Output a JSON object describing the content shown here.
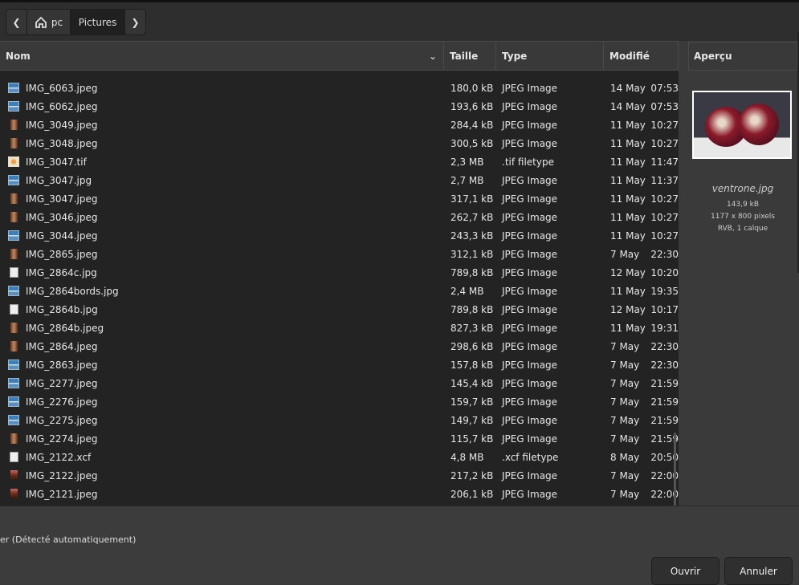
{
  "breadcrumb": {
    "home": "pc",
    "current": "Pictures"
  },
  "columns": {
    "name": "Nom",
    "size": "Taille",
    "type": "Type",
    "modified": "Modifié"
  },
  "files": [
    {
      "name": "IMG_6063.jpeg",
      "size": "180,0 kB",
      "type": "JPEG Image",
      "date": "14 May",
      "time": "07:53",
      "icon": "land"
    },
    {
      "name": "IMG_6062.jpeg",
      "size": "193,6 kB",
      "type": "JPEG Image",
      "date": "14 May",
      "time": "07:53",
      "icon": "land"
    },
    {
      "name": "IMG_3049.jpeg",
      "size": "284,4 kB",
      "type": "JPEG Image",
      "date": "11 May",
      "time": "10:27",
      "icon": "port"
    },
    {
      "name": "IMG_3048.jpeg",
      "size": "300,5 kB",
      "type": "JPEG Image",
      "date": "11 May",
      "time": "10:27",
      "icon": "port"
    },
    {
      "name": "IMG_3047.tif",
      "size": "2,3 MB",
      "type": ".tif filetype",
      "date": "11 May",
      "time": "11:47",
      "icon": "tif"
    },
    {
      "name": "IMG_3047.jpg",
      "size": "2,7 MB",
      "type": "JPEG Image",
      "date": "11 May",
      "time": "11:37",
      "icon": "land"
    },
    {
      "name": "IMG_3047.jpeg",
      "size": "317,1 kB",
      "type": "JPEG Image",
      "date": "11 May",
      "time": "10:27",
      "icon": "port"
    },
    {
      "name": "IMG_3046.jpeg",
      "size": "262,7 kB",
      "type": "JPEG Image",
      "date": "11 May",
      "time": "10:27",
      "icon": "port"
    },
    {
      "name": "IMG_3044.jpeg",
      "size": "243,3 kB",
      "type": "JPEG Image",
      "date": "11 May",
      "time": "10:27",
      "icon": "land"
    },
    {
      "name": "IMG_2865.jpeg",
      "size": "312,1 kB",
      "type": "JPEG Image",
      "date": "7 May",
      "time": "22:30",
      "icon": "port"
    },
    {
      "name": "IMG_2864c.jpg",
      "size": "789,8 kB",
      "type": "JPEG Image",
      "date": "12 May",
      "time": "10:20",
      "icon": "doc"
    },
    {
      "name": "IMG_2864bords.jpg",
      "size": "2,4 MB",
      "type": "JPEG Image",
      "date": "11 May",
      "time": "19:35",
      "icon": "land"
    },
    {
      "name": "IMG_2864b.jpg",
      "size": "789,8 kB",
      "type": "JPEG Image",
      "date": "12 May",
      "time": "10:17",
      "icon": "doc"
    },
    {
      "name": "IMG_2864b.jpeg",
      "size": "827,3 kB",
      "type": "JPEG Image",
      "date": "11 May",
      "time": "19:31",
      "icon": "port"
    },
    {
      "name": "IMG_2864.jpeg",
      "size": "298,6 kB",
      "type": "JPEG Image",
      "date": "7 May",
      "time": "22:30",
      "icon": "port"
    },
    {
      "name": "IMG_2863.jpeg",
      "size": "157,8 kB",
      "type": "JPEG Image",
      "date": "7 May",
      "time": "22:30",
      "icon": "land"
    },
    {
      "name": "IMG_2277.jpeg",
      "size": "145,4 kB",
      "type": "JPEG Image",
      "date": "7 May",
      "time": "21:59",
      "icon": "land"
    },
    {
      "name": "IMG_2276.jpeg",
      "size": "159,7 kB",
      "type": "JPEG Image",
      "date": "7 May",
      "time": "21:59",
      "icon": "land"
    },
    {
      "name": "IMG_2275.jpeg",
      "size": "149,7 kB",
      "type": "JPEG Image",
      "date": "7 May",
      "time": "21:59",
      "icon": "land"
    },
    {
      "name": "IMG_2274.jpeg",
      "size": "115,7 kB",
      "type": "JPEG Image",
      "date": "7 May",
      "time": "21:59",
      "icon": "port"
    },
    {
      "name": "IMG_2122.xcf",
      "size": "4,8 MB",
      "type": ".xcf filetype",
      "date": "8 May",
      "time": "20:50",
      "icon": "doc"
    },
    {
      "name": "IMG_2122.jpeg",
      "size": "217,2 kB",
      "type": "JPEG Image",
      "date": "7 May",
      "time": "22:00",
      "icon": "dark"
    },
    {
      "name": "IMG_2121.jpeg",
      "size": "206,1 kB",
      "type": "JPEG Image",
      "date": "7 May",
      "time": "22:00",
      "icon": "dark"
    }
  ],
  "preview": {
    "title": "Aperçu",
    "filename": "ventrone.jpg",
    "size": "143,9 kB",
    "dimensions": "1177 x 800 pixels",
    "info": "RVB, 1 calque"
  },
  "filetype_label": "er (Détecté automatiquement)",
  "buttons": {
    "open": "Ouvrir",
    "cancel": "Annuler"
  }
}
